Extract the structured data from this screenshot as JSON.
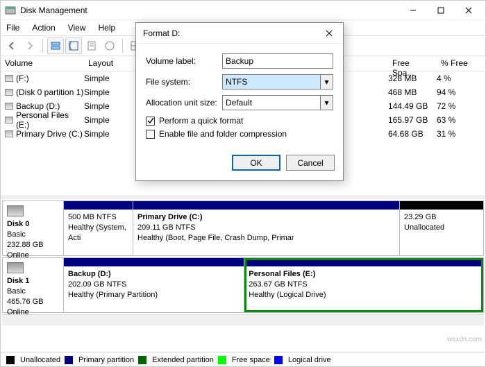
{
  "app": {
    "title": "Disk Management"
  },
  "menu": {
    "file": "File",
    "action": "Action",
    "view": "View",
    "help": "Help"
  },
  "columns": {
    "volume": "Volume",
    "layout": "Layout",
    "freeSpace": "Free Spa...",
    "pctFree": "% Free"
  },
  "volumes": [
    {
      "name": "(F:)",
      "layout": "Simple",
      "free": "328 MB",
      "pct": "4 %"
    },
    {
      "name": "(Disk 0 partition 1)",
      "layout": "Simple",
      "free": "468 MB",
      "pct": "94 %"
    },
    {
      "name": "Backup (D:)",
      "layout": "Simple",
      "free": "144.49 GB",
      "pct": "72 %"
    },
    {
      "name": "Personal Files (E:)",
      "layout": "Simple",
      "free": "165.97 GB",
      "pct": "63 %"
    },
    {
      "name": "Primary Drive (C:)",
      "layout": "Simple",
      "free": "64.68 GB",
      "pct": "31 %"
    }
  ],
  "disks": {
    "d0": {
      "title": "Disk 0",
      "type": "Basic",
      "size": "232.88 GB",
      "status": "Online",
      "p0": {
        "line1": "500 MB NTFS",
        "line2": "Healthy (System, Acti"
      },
      "p1": {
        "title": "Primary Drive  (C:)",
        "line1": "209.11 GB NTFS",
        "line2": "Healthy (Boot, Page File, Crash Dump, Primar"
      },
      "p2": {
        "line1": "23.29 GB",
        "line2": "Unallocated"
      }
    },
    "d1": {
      "title": "Disk 1",
      "type": "Basic",
      "size": "465.76 GB",
      "status": "Online",
      "p0": {
        "title": "Backup  (D:)",
        "line1": "202.09 GB NTFS",
        "line2": "Healthy (Primary Partition)"
      },
      "p1": {
        "title": "Personal Files  (E:)",
        "line1": "263.67 GB NTFS",
        "line2": "Healthy (Logical Drive)"
      }
    }
  },
  "legend": {
    "unallocated": "Unallocated",
    "primary": "Primary partition",
    "extended": "Extended partition",
    "free": "Free space",
    "logical": "Logical drive"
  },
  "dialog": {
    "title": "Format D:",
    "labels": {
      "volume": "Volume label:",
      "fs": "File system:",
      "aus": "Allocation unit size:"
    },
    "values": {
      "volume": "Backup",
      "fs": "NTFS",
      "aus": "Default"
    },
    "checks": {
      "quick": "Perform a quick format",
      "compress": "Enable file and folder compression"
    },
    "buttons": {
      "ok": "OK",
      "cancel": "Cancel"
    }
  },
  "watermark": "wsxdn.com"
}
